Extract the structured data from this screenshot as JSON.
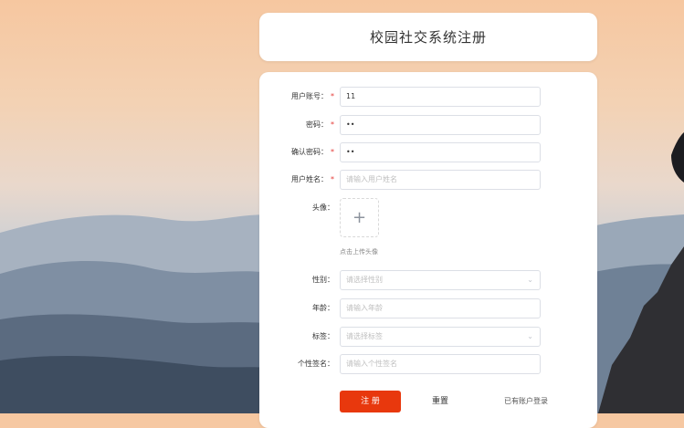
{
  "header": {
    "title": "校园社交系统注册"
  },
  "form": {
    "account": {
      "label": "用户账号：",
      "value": "11"
    },
    "password": {
      "label": "密码：",
      "value": "••"
    },
    "confirm_password": {
      "label": "确认密码：",
      "value": "••"
    },
    "name": {
      "label": "用户姓名：",
      "placeholder": "请输入用户姓名"
    },
    "avatar": {
      "label": "头像：",
      "hint": "点击上传头像"
    },
    "gender": {
      "label": "性别：",
      "placeholder": "请选择性别"
    },
    "age": {
      "label": "年龄：",
      "placeholder": "请输入年龄"
    },
    "tags": {
      "label": "标签：",
      "placeholder": "请选择标签"
    },
    "signature": {
      "label": "个性签名：",
      "placeholder": "请输入个性签名"
    },
    "required_mark": "*"
  },
  "actions": {
    "register": "注 册",
    "reset": "重置",
    "login_link": "已有账户登录"
  },
  "colors": {
    "accent": "#e8380d",
    "required": "#e53935"
  }
}
